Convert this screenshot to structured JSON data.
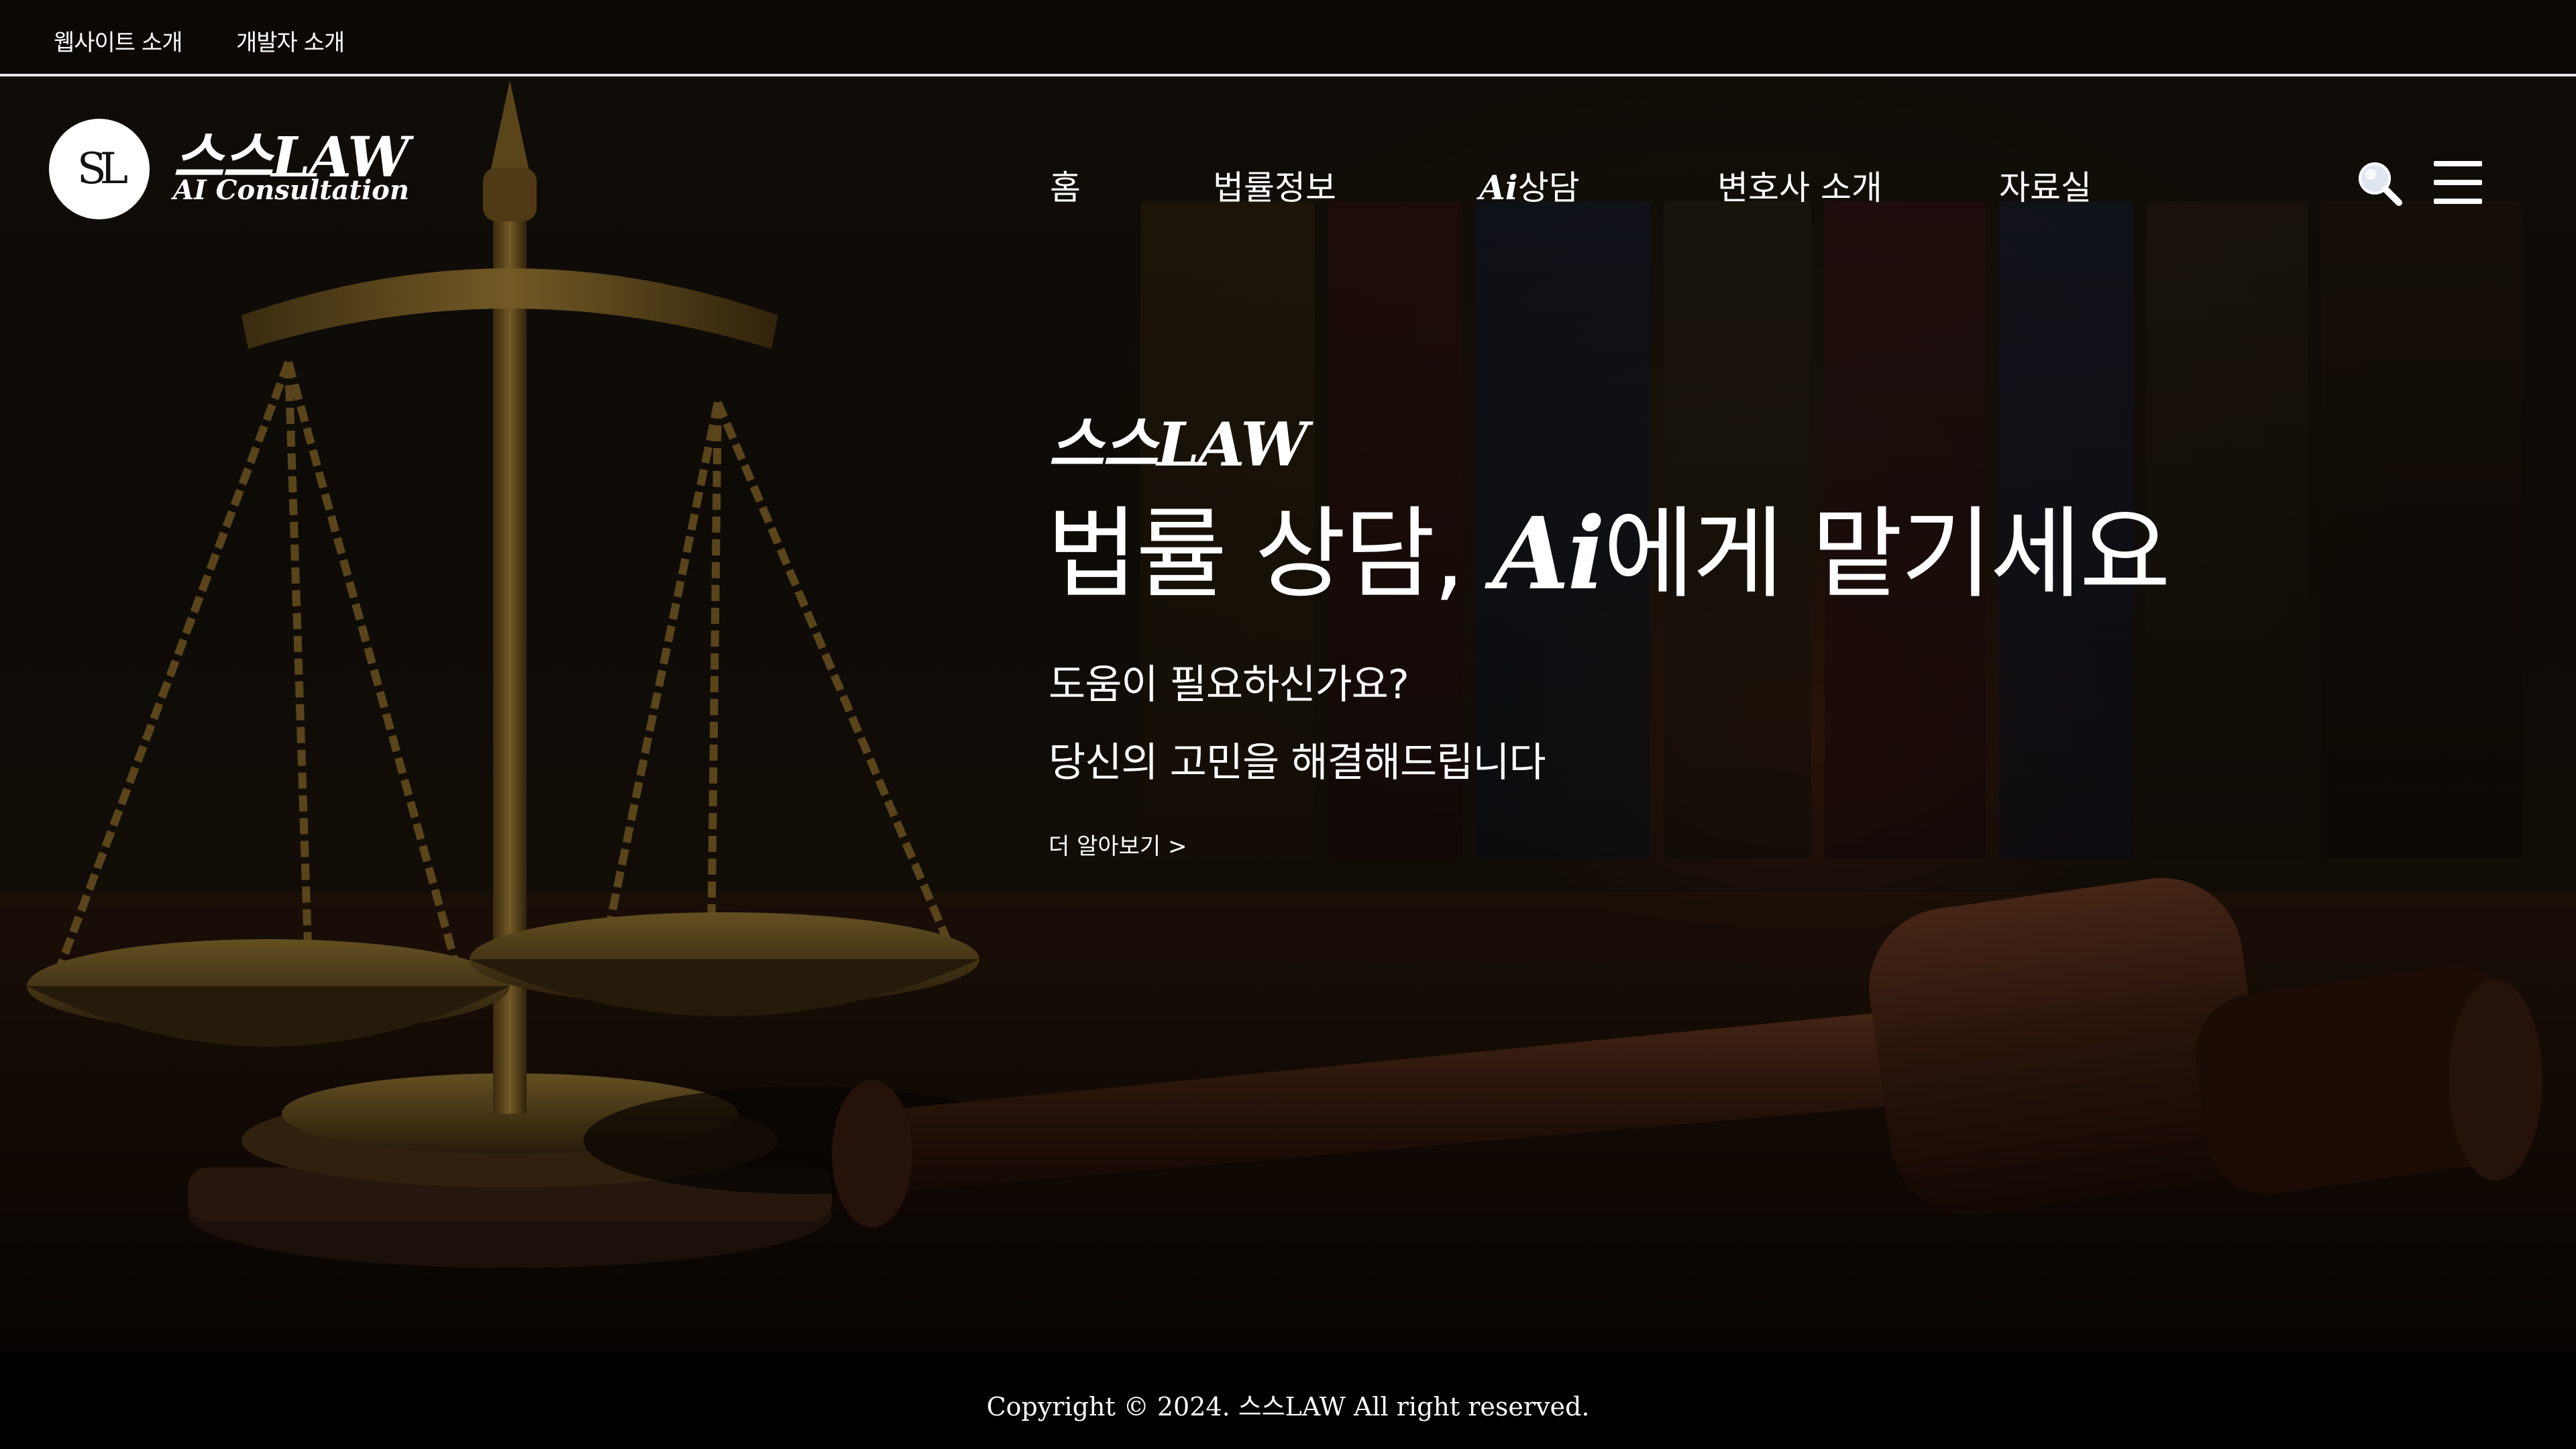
{
  "topbar": {
    "links": [
      "웹사이트 소개",
      "개발자 소개"
    ]
  },
  "logo": {
    "monogram": "SL",
    "title": "스스LAW",
    "subtitle": "AI Consultation"
  },
  "nav": {
    "items": [
      {
        "label": "홈"
      },
      {
        "label": "법률정보"
      },
      {
        "ai": "Ai",
        "label": "상담"
      },
      {
        "label": "변호사 소개"
      },
      {
        "label": "자료실"
      }
    ],
    "icons": [
      "search-icon",
      "menu-icon"
    ]
  },
  "hero": {
    "brand": "스스LAW",
    "title_pre": "법률 상담, ",
    "title_ai": "Ai",
    "title_post": "에게 맡기세요",
    "subtitle_1": "도움이 필요하신가요?",
    "subtitle_2": "당신의 고민을 해결해드립니다",
    "more_link": "더 알아보기 >"
  },
  "footer": {
    "copyright": "Copyright © 2024. 스스LAW All right reserved."
  },
  "colors": {
    "background": "#120c07",
    "text": "#ffffff",
    "topbar_divider": "#e8e8e8",
    "footer_bg": "#000000"
  }
}
